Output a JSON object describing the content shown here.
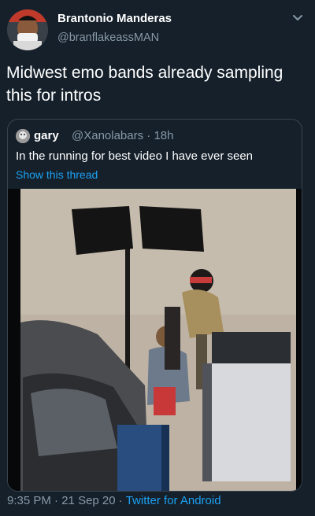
{
  "tweet": {
    "author_name": "Brantonio Manderas",
    "author_handle": "@branflakeassMAN",
    "text": "Midwest emo bands already sampling this for intros",
    "time": "9:35 PM",
    "sep1": " · ",
    "date": "21 Sep 20",
    "sep2": " · ",
    "source": "Twitter for Android"
  },
  "quoted": {
    "author_name": "gary",
    "author_handle": "@Xanolabars",
    "sep": " · ",
    "age": "18h",
    "text": "In the running for best video I have ever seen",
    "thread_link": "Show this thread"
  },
  "icons": [
    "avatar",
    "chevron-down-icon",
    "quoted-avatar"
  ],
  "colors": {
    "background": "#15202b",
    "text": "#ffffff",
    "secondary": "#8899a6",
    "link": "#1da1f2",
    "border": "#38444d"
  }
}
